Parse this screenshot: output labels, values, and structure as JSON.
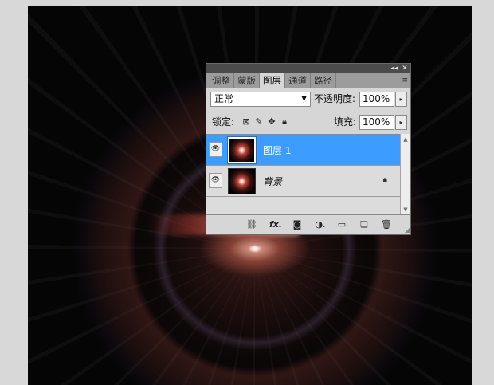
{
  "panel": {
    "title_controls": [
      "◂◂",
      "✕"
    ],
    "tabs": [
      "调整",
      "蒙版",
      "图层",
      "通道",
      "路径"
    ],
    "active_tab": "图层",
    "menu_icon": "≡",
    "blend_mode": "正常",
    "opacity_label": "不透明度:",
    "opacity_value": "100%",
    "lock_label": "锁定:",
    "fill_label": "填充:",
    "fill_value": "100%",
    "layers": [
      {
        "name": "图层 1",
        "selected": true
      },
      {
        "name": "背景",
        "selected": false,
        "locked": true
      }
    ],
    "footer_icons": [
      "link-icon",
      "fx-icon",
      "mask-icon",
      "adjustment-icon",
      "group-icon",
      "new-layer-icon",
      "trash-icon"
    ]
  },
  "colors": {
    "selection": "#3d9cff",
    "titlebar": "#4b4b4b",
    "panel_bg": "#d6d6d6"
  }
}
